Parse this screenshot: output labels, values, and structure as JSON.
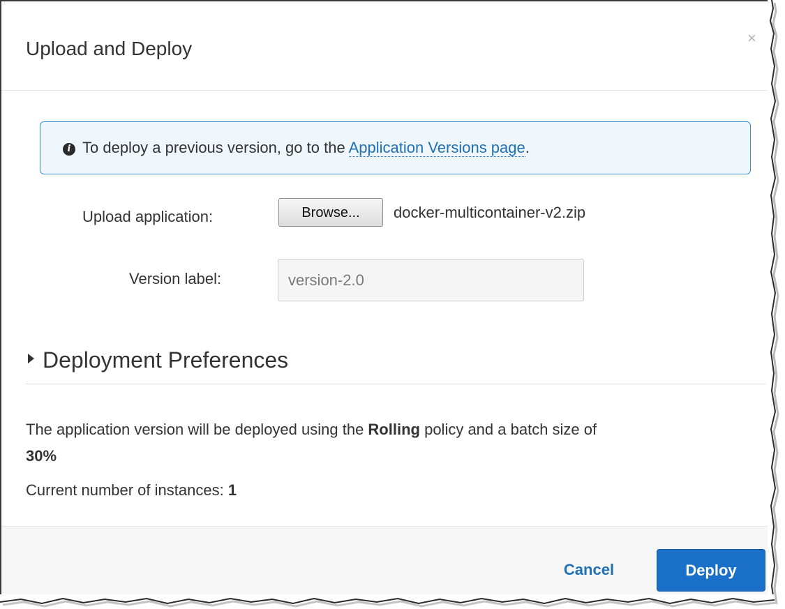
{
  "dialog": {
    "title": "Upload and Deploy",
    "close_glyph": "×"
  },
  "info": {
    "icon": "info-icon",
    "icon_glyph": "i",
    "text": "To deploy a previous version, go to the ",
    "link_text": "Application Versions page",
    "suffix": "."
  },
  "upload": {
    "label": "Upload application:",
    "browse_label": "Browse...",
    "file_name": "docker-multicontainer-v2.zip"
  },
  "version": {
    "label": "Version label:",
    "value": "version-2.0"
  },
  "preferences": {
    "toggle_label": "Deployment Preferences",
    "policy_prefix": "The application version will be deployed using the ",
    "policy_name": "Rolling",
    "policy_middle": " policy and a batch size of ",
    "batch_size": "30%",
    "instances_label": "Current number of instances: ",
    "instances_count": "1"
  },
  "footer": {
    "cancel_label": "Cancel",
    "deploy_label": "Deploy"
  },
  "colors": {
    "accent": "#1a6fc9",
    "link": "#1f70b5",
    "info_border": "#2e91d5",
    "info_background": "#eff7fd"
  }
}
